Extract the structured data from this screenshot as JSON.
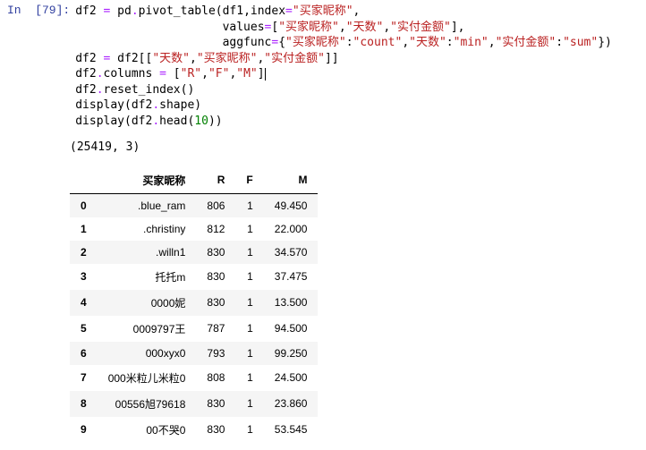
{
  "prompt": "In  [79]:",
  "code": {
    "line1_pre": "df2 ",
    "line1_assign": "=",
    "line1_post": " pd",
    "line1_dot1": ".",
    "line1_pivot": "pivot_table(df1,index",
    "line1_eq1": "=",
    "s_buyer": "\"买家昵称\"",
    "line1_c1": ",",
    "line2_pre": "                     values",
    "line2_eq": "=",
    "line2_ob": "[",
    "s_days": "\"天数\"",
    "s_paid": "\"实付金额\"",
    "line2_cb": "],",
    "line3_pre": "                     aggfunc",
    "line3_eq": "=",
    "line3_ob": "{",
    "line3_c": ":",
    "s_count": "\"count\"",
    "s_min": "\"min\"",
    "s_sum": "\"sum\"",
    "line3_cb": "})",
    "line4_pre": "df2 ",
    "line4_eq": "=",
    "line4_post": " df2[[",
    "line4_end": "]]",
    "line5_pre": "df2",
    "line5_dot": ".",
    "line5_col": "columns ",
    "line5_eq": "=",
    "line5_ob": " [",
    "s_R": "\"R\"",
    "s_F": "\"F\"",
    "s_M": "\"M\"",
    "line5_cb": "]",
    "line6": "df2",
    "line6_dot": ".",
    "line6_rest": "reset_index()",
    "line7_a": "display(df2",
    "line7_dot": ".",
    "line7_b": "shape)",
    "line8_a": "display(df2",
    "line8_dot": ".",
    "line8_b": "head(",
    "n10": "10",
    "line8_c": "))",
    "comma": ",",
    "comma_sp": ", "
  },
  "output_shape": "(25419, 3)",
  "table": {
    "headers": [
      "买家昵称",
      "R",
      "F",
      "M"
    ],
    "rows": [
      {
        "idx": "0",
        "name": ".blue_ram",
        "R": "806",
        "F": "1",
        "M": "49.450"
      },
      {
        "idx": "1",
        "name": ".christiny",
        "R": "812",
        "F": "1",
        "M": "22.000"
      },
      {
        "idx": "2",
        "name": ".willn1",
        "R": "830",
        "F": "1",
        "M": "34.570"
      },
      {
        "idx": "3",
        "name": "托托m",
        "R": "830",
        "F": "1",
        "M": "37.475"
      },
      {
        "idx": "4",
        "name": "0000妮",
        "R": "830",
        "F": "1",
        "M": "13.500"
      },
      {
        "idx": "5",
        "name": "0009797王",
        "R": "787",
        "F": "1",
        "M": "94.500"
      },
      {
        "idx": "6",
        "name": "000xyx0",
        "R": "793",
        "F": "1",
        "M": "99.250"
      },
      {
        "idx": "7",
        "name": "000米粒儿米粒0",
        "R": "808",
        "F": "1",
        "M": "24.500"
      },
      {
        "idx": "8",
        "name": "00556旭79618",
        "R": "830",
        "F": "1",
        "M": "23.860"
      },
      {
        "idx": "9",
        "name": "00不哭0",
        "R": "830",
        "F": "1",
        "M": "53.545"
      }
    ]
  }
}
